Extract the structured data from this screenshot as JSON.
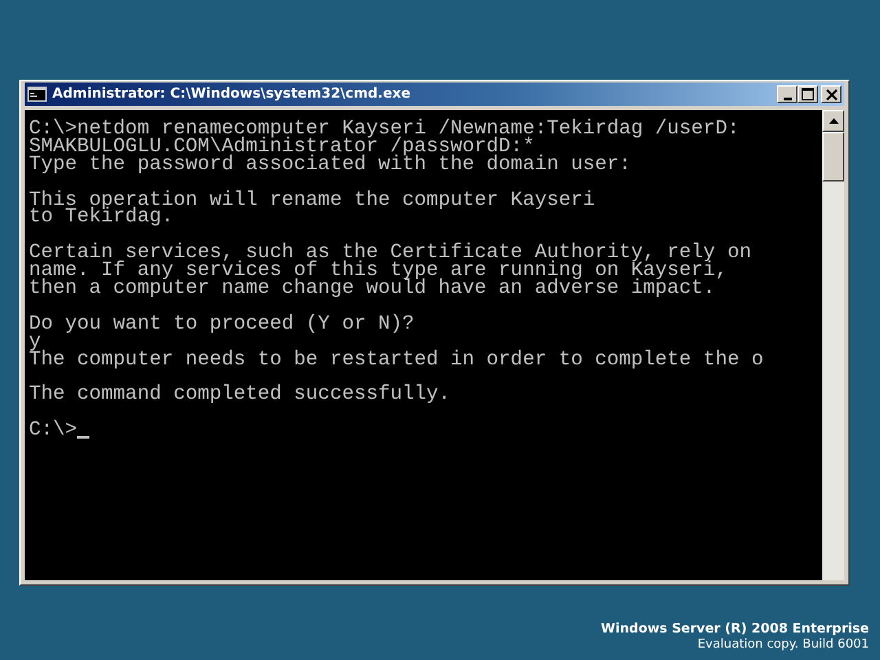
{
  "window": {
    "title": "Administrator: C:\\Windows\\system32\\cmd.exe"
  },
  "console": {
    "blocks": [
      {
        "kind": "output",
        "lines": [
          "C:\\>netdom renamecomputer Kayseri /Newname:Tekirdag /userD:",
          "SMAKBULOGLU.COM\\Administrator /passwordD:*",
          "Type the password associated with the domain user:"
        ]
      },
      {
        "kind": "output",
        "lines": [
          "This operation will rename the computer Kayseri",
          "to Tekirdag."
        ]
      },
      {
        "kind": "output",
        "lines": [
          "Certain services, such as the Certificate Authority, rely on",
          "name. If any services of this type are running on Kayseri,",
          "then a computer name change would have an adverse impact."
        ]
      },
      {
        "kind": "output",
        "lines": [
          "Do you want to proceed (Y or N)?",
          "y",
          "The computer needs to be restarted in order to complete the o"
        ]
      },
      {
        "kind": "output",
        "lines": [
          "The command completed successfully."
        ]
      },
      {
        "kind": "prompt",
        "lines": [
          "C:\\>"
        ]
      }
    ]
  },
  "branding": {
    "product": "Windows Server (R) 2008 Enterprise",
    "edition": "Evaluation copy. Build 6001"
  }
}
